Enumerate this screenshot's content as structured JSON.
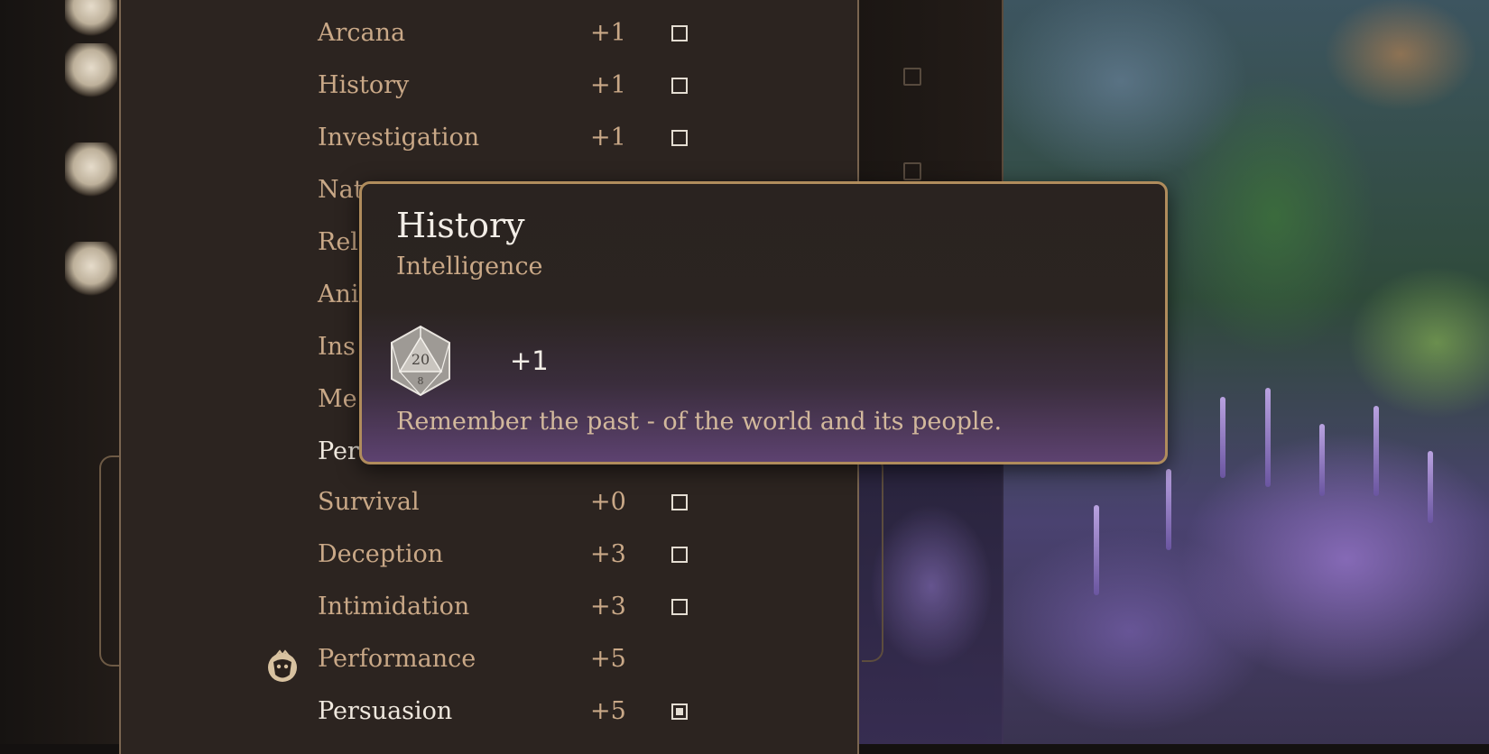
{
  "skills": [
    {
      "name": "Arcana",
      "modifier": "+1",
      "proficient": false
    },
    {
      "name": "History",
      "modifier": "+1",
      "proficient": false
    },
    {
      "name": "Investigation",
      "modifier": "+1",
      "proficient": false
    },
    {
      "name": "Nat",
      "modifier": "",
      "proficient": false
    },
    {
      "name": "Rel",
      "modifier": "",
      "proficient": false
    },
    {
      "name": "Ani",
      "modifier": "",
      "proficient": false
    },
    {
      "name": "Ins",
      "modifier": "",
      "proficient": false
    },
    {
      "name": "Me",
      "modifier": "",
      "proficient": false
    },
    {
      "name": "Per",
      "modifier": "",
      "proficient": false
    },
    {
      "name": "Survival",
      "modifier": "+0",
      "proficient": false
    },
    {
      "name": "Deception",
      "modifier": "+3",
      "proficient": false
    },
    {
      "name": "Intimidation",
      "modifier": "+3",
      "proficient": false
    },
    {
      "name": "Performance",
      "modifier": "+5",
      "proficient": false
    },
    {
      "name": "Persuasion",
      "modifier": "+5",
      "proficient": true
    }
  ],
  "tooltip": {
    "title": "History",
    "ability": "Intelligence",
    "die_face": "20",
    "die_sub": "8",
    "modifier": "+1",
    "description": "Remember the past - of the world and its people."
  },
  "icons": {
    "die": "d20-icon",
    "performance_badge": "performance-mask-icon"
  },
  "colors": {
    "panel_bg": "#2c2420",
    "label_tan": "#c9a887",
    "label_white": "#efe8de",
    "tooltip_border": "#b08c5c",
    "tooltip_purple": "#5d4270"
  }
}
